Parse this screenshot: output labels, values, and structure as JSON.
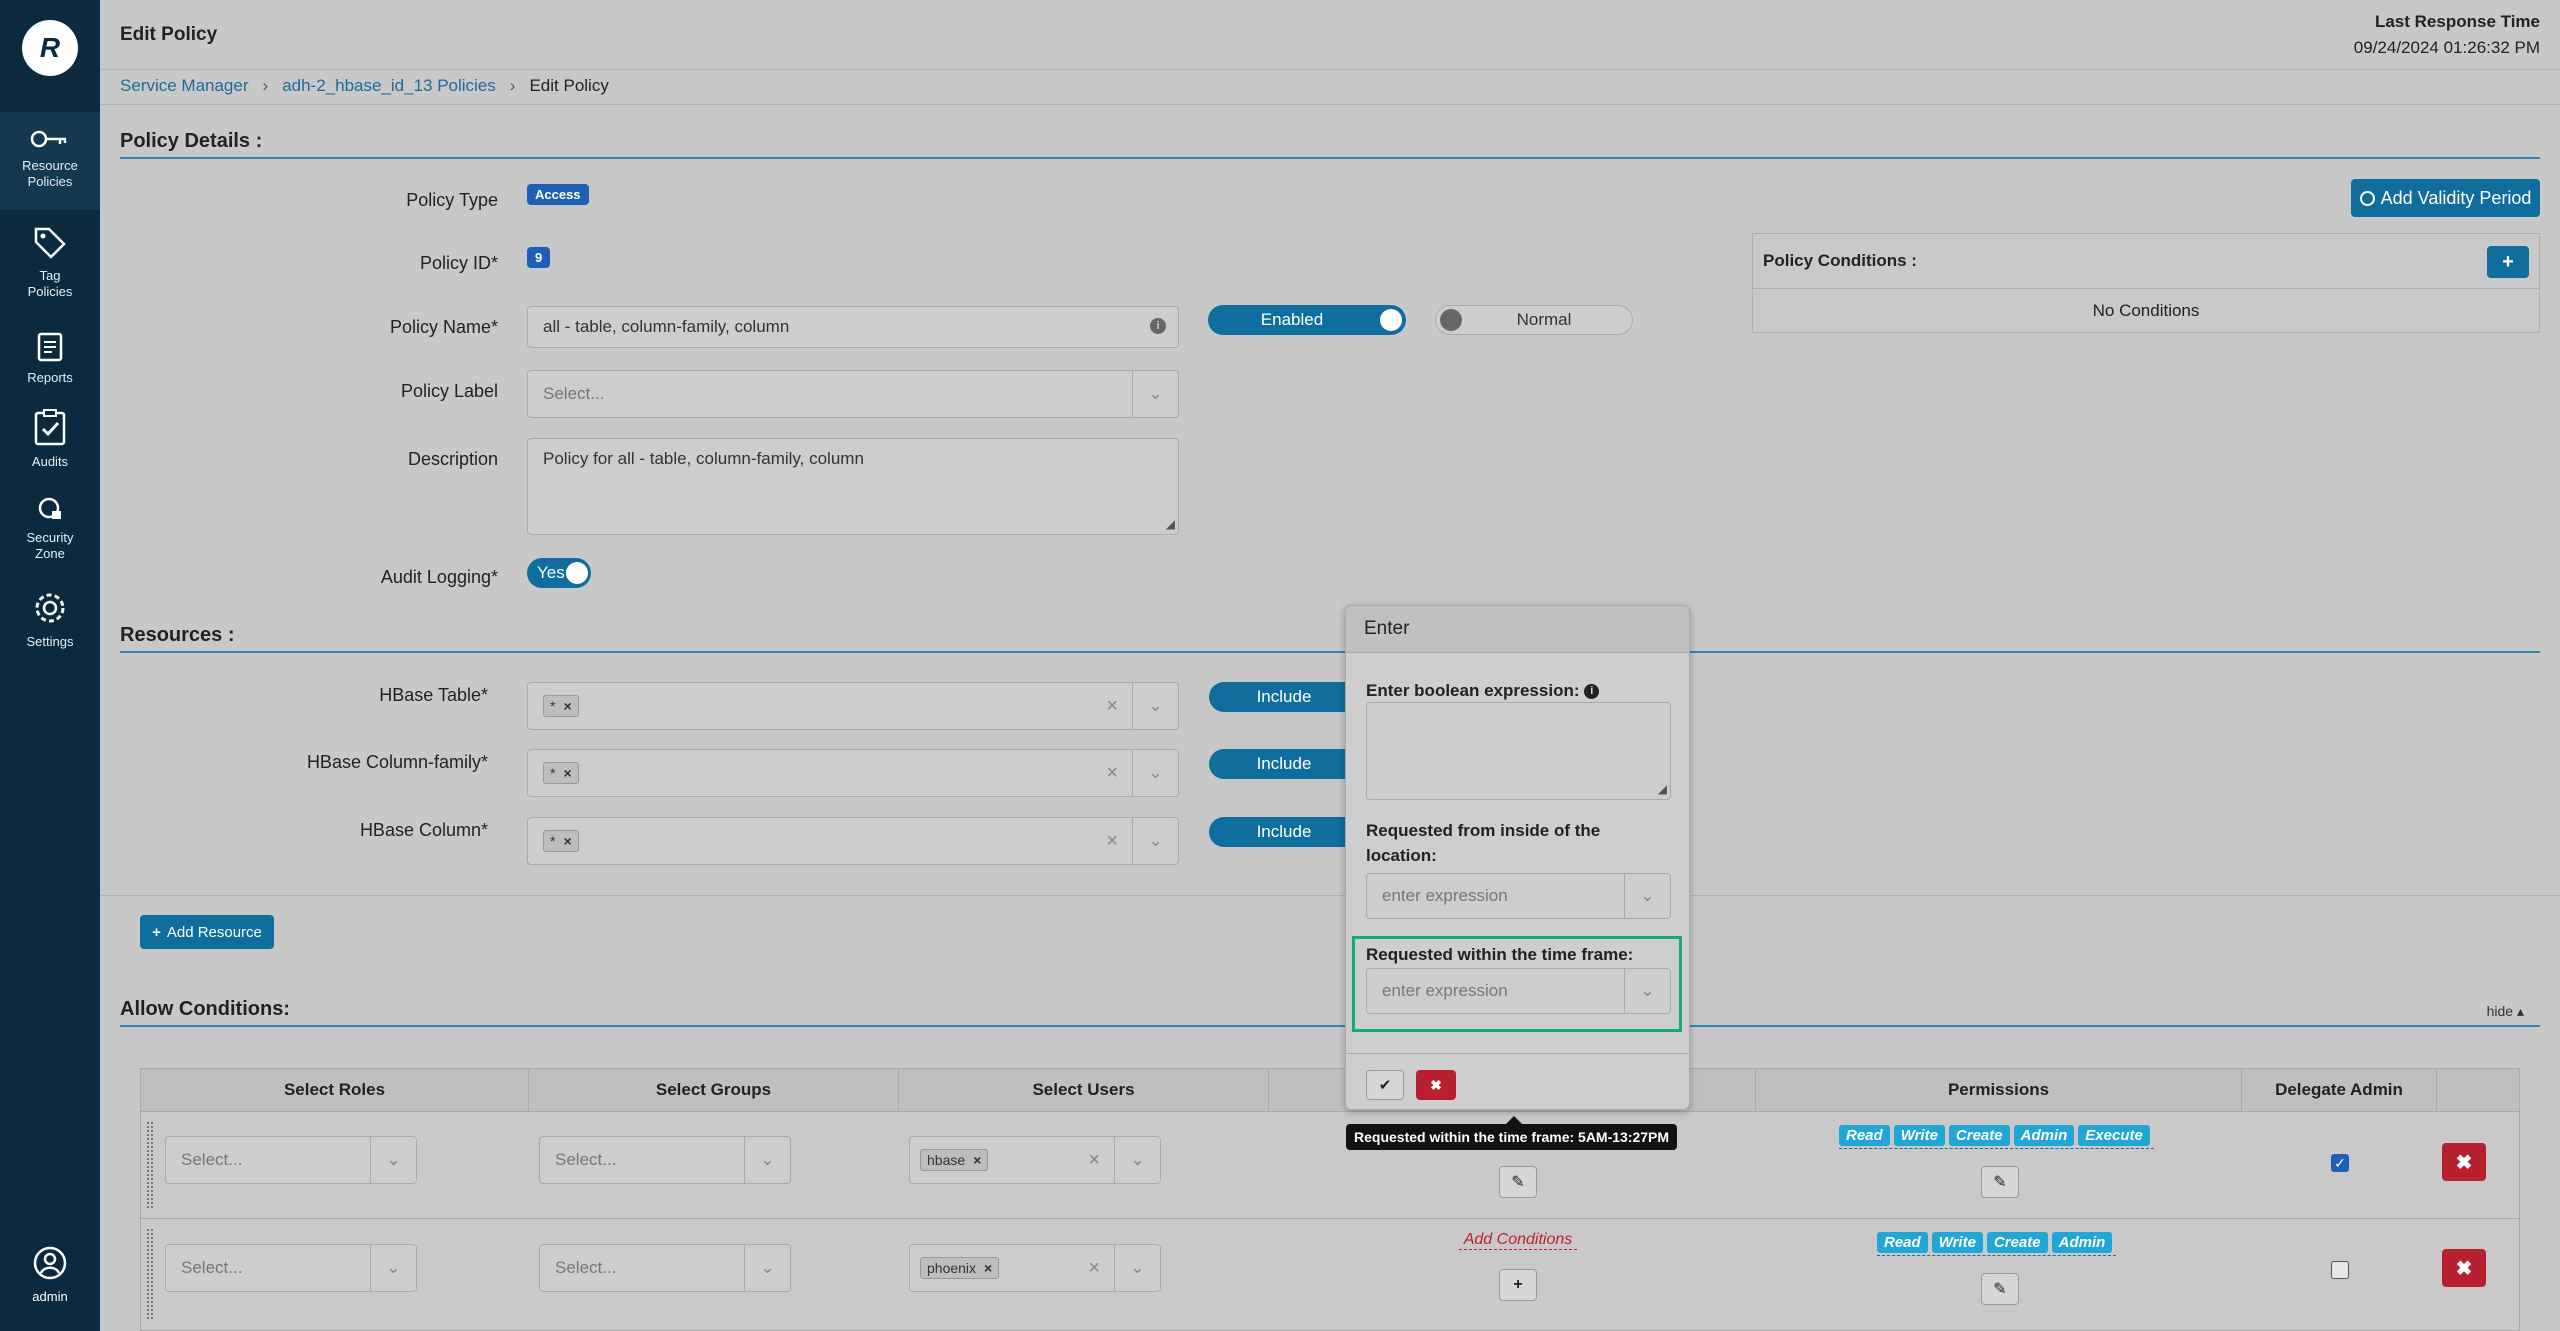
{
  "sidebar": {
    "logo_letter": "R",
    "items": [
      {
        "label_line1": "Resource",
        "label_line2": "Policies"
      },
      {
        "label_line1": "Tag",
        "label_line2": "Policies"
      },
      {
        "label_line1": "Reports",
        "label_line2": ""
      },
      {
        "label_line1": "Audits",
        "label_line2": ""
      },
      {
        "label_line1": "Security",
        "label_line2": "Zone"
      },
      {
        "label_line1": "Settings",
        "label_line2": ""
      }
    ],
    "user": "admin"
  },
  "header": {
    "title": "Edit Policy",
    "last_response_label": "Last Response Time",
    "last_response_value": "09/24/2024 01:26:32 PM"
  },
  "breadcrumb": [
    "Service Manager",
    "adh-2_hbase_id_13 Policies",
    "Edit Policy"
  ],
  "policy_details": {
    "section_title": "Policy Details :",
    "type_label": "Policy Type",
    "type_value": "Access",
    "id_label": "Policy ID*",
    "id_value": "9",
    "name_label": "Policy Name*",
    "name_value": "all - table, column-family, column",
    "enabled_label": "Enabled",
    "priority_label": "Normal",
    "label_label": "Policy Label",
    "label_placeholder": "Select...",
    "description_label": "Description",
    "description_value": "Policy for all - table, column-family, column",
    "audit_label": "Audit Logging*",
    "audit_value": "Yes",
    "add_validity_label": "Add Validity Period",
    "conditions_title": "Policy Conditions :",
    "conditions_empty": "No Conditions"
  },
  "resources": {
    "section_title": "Resources :",
    "rows": [
      {
        "label": "HBase Table*",
        "tag": "*",
        "include": "Include"
      },
      {
        "label": "HBase Column-family*",
        "tag": "*",
        "include": "Include"
      },
      {
        "label": "HBase Column*",
        "tag": "*",
        "include": "Include"
      }
    ],
    "add_resource_label": "Add Resource"
  },
  "allow": {
    "section_title": "Allow Conditions:",
    "hide_label": "hide",
    "columns": [
      "Select Roles",
      "Select Groups",
      "Select Users",
      "Permissions",
      "Delegate Admin"
    ],
    "select_placeholder": "Select...",
    "rows": [
      {
        "user": "hbase",
        "permissions": [
          "Read",
          "Write",
          "Create",
          "Admin",
          "Execute"
        ],
        "delegate": true,
        "conditions": ""
      },
      {
        "user": "phoenix",
        "permissions": [
          "Read",
          "Write",
          "Create",
          "Admin"
        ],
        "delegate": false,
        "conditions": "Add Conditions"
      }
    ]
  },
  "popover": {
    "title": "Enter",
    "boolean_label": "Enter boolean expression:",
    "location_label_line1": "Requested from inside of the",
    "location_label_line2": "location:",
    "location_placeholder": "enter expression",
    "timeframe_label": "Requested within the time frame:",
    "timeframe_placeholder": "enter expression"
  },
  "tooltip": "Requested within the time frame: 5AM-13:27PM",
  "colors": {
    "sidebar": "#0b2a3f",
    "primary": "#0f6e9e",
    "danger": "#b8202f",
    "highlight": "#1aa57a"
  }
}
